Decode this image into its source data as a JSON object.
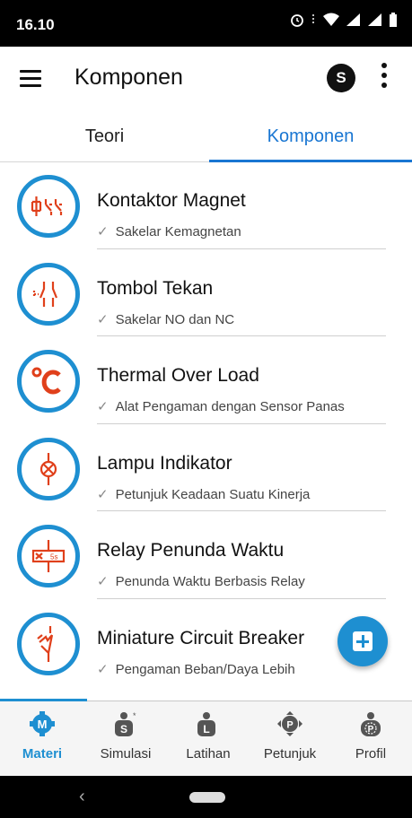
{
  "status_bar": {
    "time": "16.10"
  },
  "app_bar": {
    "title": "Komponen",
    "avatar_letter": "S"
  },
  "tabs": [
    {
      "label": "Teori",
      "selected": false
    },
    {
      "label": "Komponen",
      "selected": true
    }
  ],
  "items": [
    {
      "name": "Kontaktor Magnet",
      "subtitle": "Sakelar Kemagnetan",
      "icon": "contactor-symbol-icon"
    },
    {
      "name": "Tombol Tekan",
      "subtitle": "Sakelar NO dan NC",
      "icon": "push-button-symbol-icon"
    },
    {
      "name": "Thermal Over Load",
      "subtitle": "Alat Pengaman dengan Sensor Panas",
      "icon": "thermal-celsius-icon"
    },
    {
      "name": "Lampu Indikator",
      "subtitle": "Petunjuk Keadaan Suatu Kinerja",
      "icon": "indicator-lamp-icon"
    },
    {
      "name": "Relay Penunda Waktu",
      "subtitle": "Penunda Waktu Berbasis Relay",
      "icon": "timer-relay-icon",
      "icon_text": "5s"
    },
    {
      "name": "Miniature Circuit Breaker",
      "subtitle": "Pengaman Beban/Daya Lebih",
      "icon": "circuit-breaker-icon"
    }
  ],
  "bottom_nav": [
    {
      "label": "Materi",
      "icon_letter": "M",
      "active": true
    },
    {
      "label": "Simulasi",
      "icon_letter": "S",
      "active": false
    },
    {
      "label": "Latihan",
      "icon_letter": "L",
      "active": false
    },
    {
      "label": "Petunjuk",
      "icon_letter": "P",
      "active": false
    },
    {
      "label": "Profil",
      "icon_letter": "P",
      "active": false
    }
  ],
  "colors": {
    "accent": "#1e8fd1",
    "tab_active": "#1976d2",
    "icon_red": "#e0401b"
  }
}
